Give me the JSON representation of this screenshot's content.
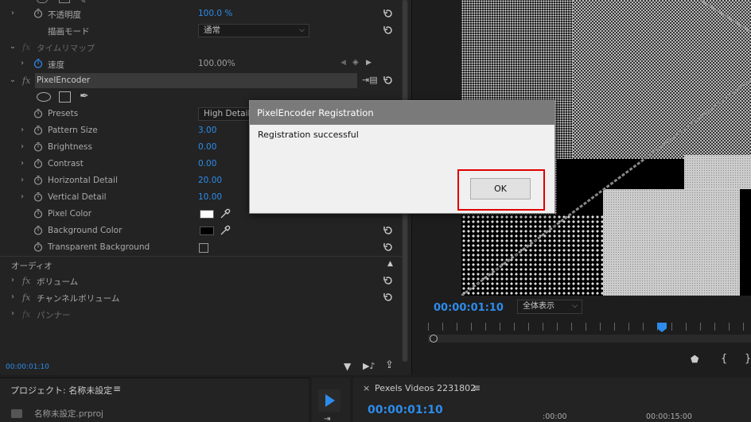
{
  "effects": {
    "rows": [
      {
        "label": "不透明度",
        "value": "100.0 %"
      },
      {
        "label": "描画モード",
        "value": "通常"
      },
      {
        "label": "タイムリマップ"
      },
      {
        "label": "速度",
        "value": "100.00%"
      },
      {
        "label": "PixelEncoder"
      },
      {
        "label": "Presets",
        "value": "High Detail"
      },
      {
        "label": "Pattern Size",
        "value": "3.00"
      },
      {
        "label": "Brightness",
        "value": "0.00"
      },
      {
        "label": "Contrast",
        "value": "0.00"
      },
      {
        "label": "Horizontal Detail",
        "value": "20.00"
      },
      {
        "label": "Vertical Detail",
        "value": "10.00"
      },
      {
        "label": "Pixel Color",
        "color": "#ffffff"
      },
      {
        "label": "Background Color",
        "color": "#000000"
      },
      {
        "label": "Transparent Background",
        "checked": false
      },
      {
        "label": "オーディオ"
      },
      {
        "label": "ボリューム"
      },
      {
        "label": "チャンネルボリューム"
      },
      {
        "label": "パンナー"
      }
    ],
    "fx_symbol": "fx",
    "timecode": "00:00:01:10"
  },
  "monitor": {
    "timecode": "00:00:01:10",
    "zoom": "全体表示"
  },
  "dialog": {
    "title": "PixelEncoder Registration",
    "message": "Registration successful",
    "ok_label": "OK"
  },
  "project": {
    "tab_label": "プロジェクト: 名称未設定",
    "file": "名称未設定.prproj"
  },
  "timeline": {
    "tab_label": "Pexels Videos 2231802",
    "timecode": "00:00:01:10",
    "ticks": [
      ":00:00",
      "00:00:15:00"
    ]
  },
  "colors": {
    "accent": "#2d8ceb",
    "highlight": "#e10000"
  }
}
